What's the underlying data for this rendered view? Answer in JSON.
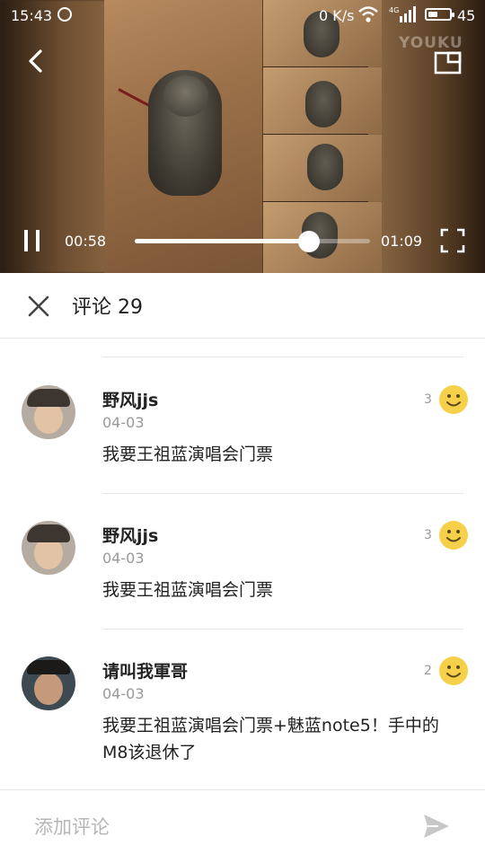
{
  "status_bar": {
    "time": "15:43",
    "network_speed": "0 K/s",
    "network_type": "4G",
    "battery_percent": "45",
    "battery_level": 0.45
  },
  "video": {
    "watermark": "YOUKU",
    "current_time": "00:58",
    "total_time": "01:09",
    "progress": 0.74,
    "icons": [
      "back-icon",
      "picture-in-picture-icon",
      "pause-icon",
      "fullscreen-icon"
    ]
  },
  "comments_header": {
    "title": "评论 29"
  },
  "comments": [
    {
      "name": "野风jjs",
      "date": "04-03",
      "text": "我要王祖蓝演唱会门票",
      "likes": "3"
    },
    {
      "name": "野风jjs",
      "date": "04-03",
      "text": "我要王祖蓝演唱会门票",
      "likes": "3"
    },
    {
      "name": "请叫我軍哥",
      "date": "04-03",
      "text": "我要王祖蓝演唱会门票+魅蓝note5！手中的M8该退休了",
      "likes": "2"
    }
  ],
  "input": {
    "placeholder": "添加评论"
  },
  "colors": {
    "accent_smile": "#f7d04a",
    "send_icon": "#c8c8c8",
    "divider": "#e6e6e6"
  }
}
